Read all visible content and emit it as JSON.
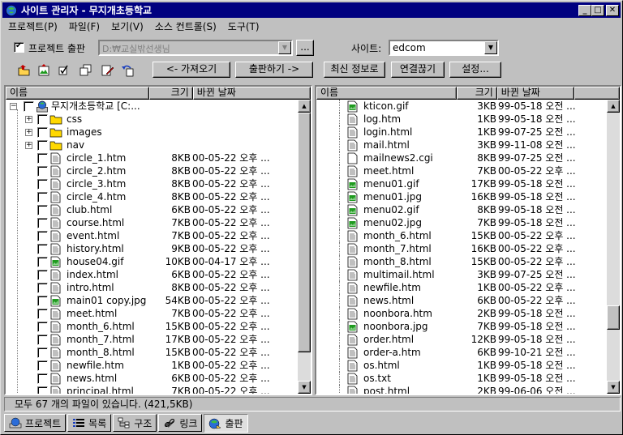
{
  "window": {
    "title": "사이트 관리자 - 무지개초등학교"
  },
  "menu": [
    "프로젝트(P)",
    "파일(F)",
    "보기(V)",
    "소스 컨트롤(S)",
    "도구(T)"
  ],
  "publish": {
    "checkbox_label": "프로젝트 출판",
    "path": "D:₩교실밖선생님",
    "browse_label": "...",
    "site_label": "사이트:",
    "site_value": "edcom"
  },
  "buttons": {
    "get": "<- 가져오기",
    "put": "출판하기 ->",
    "refresh": "최신 정보로",
    "disconnect": "연결끊기",
    "settings": "설정..."
  },
  "columns": {
    "name": "이름",
    "size": "크기",
    "date": "바뀐 날짜"
  },
  "local": {
    "root": "무지개초등학교 [C:...",
    "folders": [
      "css",
      "images",
      "nav"
    ],
    "files": [
      {
        "name": "circle_1.htm",
        "size": "8KB",
        "date": "00-05-22 오후 ...",
        "type": "doc"
      },
      {
        "name": "circle_2.htm",
        "size": "8KB",
        "date": "00-05-22 오후 ...",
        "type": "doc"
      },
      {
        "name": "circle_3.htm",
        "size": "8KB",
        "date": "00-05-22 오후 ...",
        "type": "doc"
      },
      {
        "name": "circle_4.htm",
        "size": "8KB",
        "date": "00-05-22 오후 ...",
        "type": "doc"
      },
      {
        "name": "club.html",
        "size": "6KB",
        "date": "00-05-22 오후 ...",
        "type": "doc"
      },
      {
        "name": "course.html",
        "size": "7KB",
        "date": "00-05-22 오후 ...",
        "type": "doc"
      },
      {
        "name": "event.html",
        "size": "7KB",
        "date": "00-05-22 오후 ...",
        "type": "doc"
      },
      {
        "name": "history.html",
        "size": "9KB",
        "date": "00-05-22 오후 ...",
        "type": "doc"
      },
      {
        "name": "house04.gif",
        "size": "10KB",
        "date": "00-04-17 오후 ...",
        "type": "img"
      },
      {
        "name": "index.html",
        "size": "6KB",
        "date": "00-05-22 오후 ...",
        "type": "doc"
      },
      {
        "name": "intro.html",
        "size": "8KB",
        "date": "00-05-22 오후 ...",
        "type": "doc"
      },
      {
        "name": "main01 copy.jpg",
        "size": "54KB",
        "date": "00-05-22 오후 ...",
        "type": "img"
      },
      {
        "name": "meet.html",
        "size": "7KB",
        "date": "00-05-22 오후 ...",
        "type": "doc"
      },
      {
        "name": "month_6.html",
        "size": "15KB",
        "date": "00-05-22 오후 ...",
        "type": "doc"
      },
      {
        "name": "month_7.html",
        "size": "17KB",
        "date": "00-05-22 오후 ...",
        "type": "doc"
      },
      {
        "name": "month_8.html",
        "size": "15KB",
        "date": "00-05-22 오후 ...",
        "type": "doc"
      },
      {
        "name": "newfile.htm",
        "size": "1KB",
        "date": "00-05-22 오후 ...",
        "type": "doc"
      },
      {
        "name": "news.html",
        "size": "6KB",
        "date": "00-05-22 오후 ...",
        "type": "doc"
      },
      {
        "name": "principal.html",
        "size": "7KB",
        "date": "00-05-22 오후 ...",
        "type": "doc"
      }
    ]
  },
  "remote": {
    "files": [
      {
        "name": "kticon.gif",
        "size": "3KB",
        "date": "99-05-18 오전 ...",
        "type": "img"
      },
      {
        "name": "log.htm",
        "size": "1KB",
        "date": "99-05-18 오전 ...",
        "type": "doc"
      },
      {
        "name": "login.html",
        "size": "1KB",
        "date": "99-07-25 오전 ...",
        "type": "doc"
      },
      {
        "name": "mail.html",
        "size": "3KB",
        "date": "99-11-08 오전 ...",
        "type": "doc"
      },
      {
        "name": "mailnews2.cgi",
        "size": "8KB",
        "date": "99-07-25 오전 ...",
        "type": "blank"
      },
      {
        "name": "meet.html",
        "size": "7KB",
        "date": "00-05-22 오후 ...",
        "type": "doc"
      },
      {
        "name": "menu01.gif",
        "size": "17KB",
        "date": "99-05-18 오전 ...",
        "type": "img"
      },
      {
        "name": "menu01.jpg",
        "size": "16KB",
        "date": "99-05-18 오전 ...",
        "type": "img"
      },
      {
        "name": "menu02.gif",
        "size": "8KB",
        "date": "99-05-18 오전 ...",
        "type": "img"
      },
      {
        "name": "menu02.jpg",
        "size": "7KB",
        "date": "99-05-18 오전 ...",
        "type": "img"
      },
      {
        "name": "month_6.html",
        "size": "15KB",
        "date": "00-05-22 오후 ...",
        "type": "doc"
      },
      {
        "name": "month_7.html",
        "size": "16KB",
        "date": "00-05-22 오후 ...",
        "type": "doc"
      },
      {
        "name": "month_8.html",
        "size": "15KB",
        "date": "00-05-22 오후 ...",
        "type": "doc"
      },
      {
        "name": "multimail.html",
        "size": "3KB",
        "date": "99-07-25 오전 ...",
        "type": "doc"
      },
      {
        "name": "newfile.htm",
        "size": "1KB",
        "date": "00-05-22 오후 ...",
        "type": "doc"
      },
      {
        "name": "news.html",
        "size": "6KB",
        "date": "00-05-22 오후 ...",
        "type": "doc"
      },
      {
        "name": "noonbora.htm",
        "size": "2KB",
        "date": "99-05-18 오전 ...",
        "type": "doc"
      },
      {
        "name": "noonbora.jpg",
        "size": "7KB",
        "date": "99-05-18 오전 ...",
        "type": "img"
      },
      {
        "name": "order.html",
        "size": "12KB",
        "date": "99-05-18 오전 ...",
        "type": "doc"
      },
      {
        "name": "order-a.htm",
        "size": "6KB",
        "date": "99-10-21 오전 ...",
        "type": "doc"
      },
      {
        "name": "os.html",
        "size": "1KB",
        "date": "99-05-18 오전 ...",
        "type": "doc"
      },
      {
        "name": "os.txt",
        "size": "1KB",
        "date": "99-05-18 오전 ...",
        "type": "doc"
      },
      {
        "name": "post.html",
        "size": "2KB",
        "date": "99-06-06 오전 ...",
        "type": "doc"
      }
    ]
  },
  "status": "모두 67 개의 파일이 있습니다. (421,5KB)",
  "tabs": [
    "프로젝트",
    "목록",
    "구조",
    "링크",
    "출판"
  ],
  "active_tab": "출판"
}
